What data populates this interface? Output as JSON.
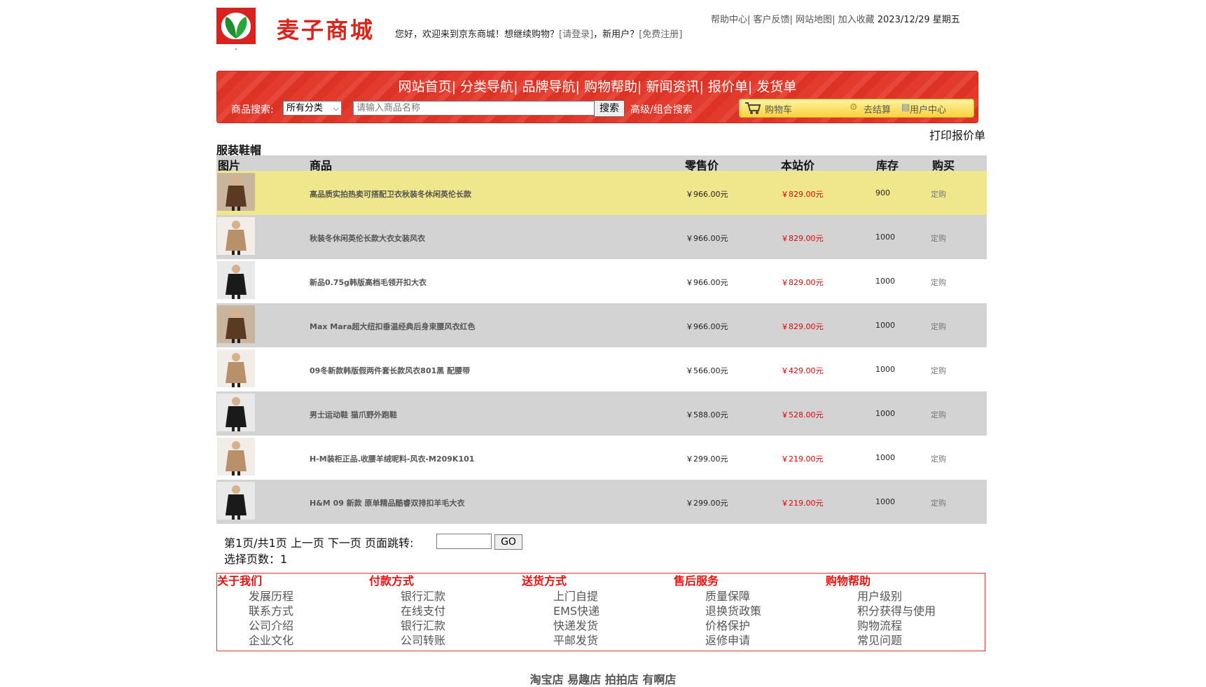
{
  "header": {
    "brand": "麦子商城",
    "welcome_text": "您好，欢迎来到京东商城！想继续购物？",
    "login_link": "[请登录]",
    "new_user_text": "，新用户？",
    "register_link": "[免费注册]",
    "top_links": [
      "帮助中心",
      "客户反馈",
      "网站地图",
      "加入收藏"
    ],
    "date": "2023/12/29 星期五"
  },
  "nav": {
    "links": [
      "网站首页",
      "分类导航",
      "品牌导航",
      "购物帮助",
      "新闻资讯",
      "报价单",
      "发货单"
    ],
    "search_label": "商品搜索:",
    "category_selected": "所有分类",
    "search_placeholder": "请输入商品名称",
    "search_button": "搜索",
    "advanced_search": "高级/组合搜索",
    "cart": "购物车",
    "checkout": "去结算",
    "user_center": "用户中心"
  },
  "print_label": "打印报价单",
  "section_title": "服装鞋帽",
  "table": {
    "headers": [
      "图片",
      "商品",
      "零售价",
      "本站价",
      "库存",
      "购买"
    ],
    "rows": [
      {
        "name": "高品质实拍热卖可搭配卫衣秋装冬休闲英伦长款",
        "retail": "￥966.00元",
        "price": "￥829.00元",
        "stock": "900",
        "order": "定购",
        "thumb": "brown-coat"
      },
      {
        "name": "秋装冬休闲英伦长款大衣女装风衣",
        "retail": "￥966.00元",
        "price": "￥829.00元",
        "stock": "1000",
        "order": "定购",
        "thumb": "beige-coat"
      },
      {
        "name": "新品0.75g韩版高档毛领开扣大衣",
        "retail": "￥966.00元",
        "price": "￥829.00元",
        "stock": "1000",
        "order": "定购",
        "thumb": "black-coat"
      },
      {
        "name": "Max Mara超大纽扣垂温经典后身束腰风衣红色",
        "retail": "￥966.00元",
        "price": "￥829.00元",
        "stock": "1000",
        "order": "定购",
        "thumb": "brown-coat"
      },
      {
        "name": "09冬新款韩版假两件套长款风衣801黑 配腰带",
        "retail": "￥566.00元",
        "price": "￥429.00元",
        "stock": "1000",
        "order": "定购",
        "thumb": "beige-coat"
      },
      {
        "name": "男士运动鞋 猫爪野外跑鞋",
        "retail": "￥588.00元",
        "price": "￥528.00元",
        "stock": "1000",
        "order": "定购",
        "thumb": "black-coat"
      },
      {
        "name": "H-M装柜正品.收腰羊绒呢料-风衣-M209K101",
        "retail": "￥299.00元",
        "price": "￥219.00元",
        "stock": "1000",
        "order": "定购",
        "thumb": "beige-coat"
      },
      {
        "name": "H&M 09 新款 原单精品酷睿双排扣羊毛大衣",
        "retail": "￥299.00元",
        "price": "￥219.00元",
        "stock": "1000",
        "order": "定购",
        "thumb": "black-coat"
      }
    ]
  },
  "pager": {
    "summary": "第1页/共1页  上一页 下一页 页面跳转:",
    "go": "GO",
    "pages": "选择页数：1"
  },
  "footer": {
    "columns": [
      {
        "title": "关于我们",
        "items": [
          "发展历程",
          "联系方式",
          "公司介绍",
          "企业文化"
        ]
      },
      {
        "title": "付款方式",
        "items": [
          "银行汇款",
          "在线支付",
          "银行汇款",
          "公司转账"
        ]
      },
      {
        "title": "送货方式",
        "items": [
          "上门自提",
          "EMS快递",
          "快递发货",
          "平邮发货"
        ]
      },
      {
        "title": "售后服务",
        "items": [
          "质量保障",
          "退换货政策",
          "价格保护",
          "返修申请"
        ]
      },
      {
        "title": "购物帮助",
        "items": [
          "用户级别",
          "积分获得与使用",
          "购物流程",
          "常见问题"
        ]
      }
    ],
    "shops": "淘宝店 易趣店 拍拍店 有啊店"
  },
  "colors": {
    "brand_red": "#d9251c",
    "price_red": "#ee0000",
    "highlight_row": "#f0e68c",
    "nav_red": "#e23a2c"
  }
}
